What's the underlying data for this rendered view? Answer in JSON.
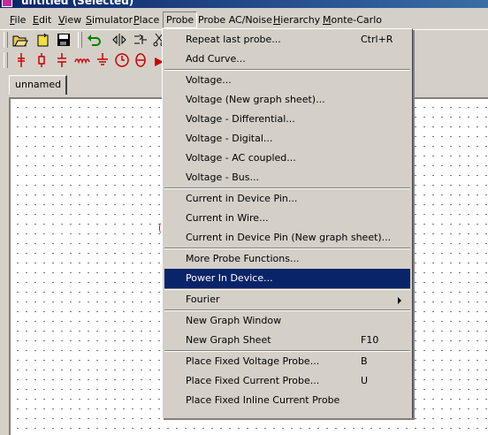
{
  "window": {
    "title": "untitled (Selected)"
  },
  "menubar": [
    {
      "label": "File",
      "u": "F",
      "rest": "ile"
    },
    {
      "label": "Edit",
      "u": "E",
      "rest": "dit"
    },
    {
      "label": "View",
      "u": "V",
      "rest": "iew"
    },
    {
      "label": "Simulator",
      "u": "S",
      "rest": "imulator"
    },
    {
      "label": "Place",
      "u": "P",
      "rest": "lace"
    },
    {
      "label": "Probe",
      "u": "",
      "rest": "Probe"
    },
    {
      "label": "Probe AC/Noise",
      "u": "",
      "rest": "Probe AC/Noise"
    },
    {
      "label": "Hierarchy",
      "u": "H",
      "rest": "ierarchy"
    },
    {
      "label": "Monte-Carlo",
      "u": "M",
      "rest": "onte-Carlo"
    }
  ],
  "tab": {
    "label": "unnamed"
  },
  "probe_menu": {
    "items": [
      {
        "label": "Repeat last probe...",
        "shortcut": "Ctrl+R"
      },
      {
        "label": "Add Curve...",
        "shortcut": ""
      },
      {
        "label": "Voltage...",
        "shortcut": ""
      },
      {
        "label": "Voltage (New graph sheet)...",
        "shortcut": ""
      },
      {
        "label": "Voltage - Differential...",
        "shortcut": ""
      },
      {
        "label": "Voltage - Digital...",
        "shortcut": ""
      },
      {
        "label": "Voltage - AC coupled...",
        "shortcut": ""
      },
      {
        "label": "Voltage - Bus...",
        "shortcut": ""
      },
      {
        "label": "Current in Device Pin...",
        "shortcut": ""
      },
      {
        "label": "Current in Wire...",
        "shortcut": ""
      },
      {
        "label": "Current in Device Pin (New graph sheet)...",
        "shortcut": ""
      },
      {
        "label": "More Probe Functions...",
        "shortcut": ""
      },
      {
        "label": "Power In Device...",
        "shortcut": ""
      },
      {
        "label": "Fourier",
        "shortcut": ""
      },
      {
        "label": "New Graph Window",
        "shortcut": ""
      },
      {
        "label": "New Graph Sheet",
        "shortcut": "F10"
      },
      {
        "label": "Place Fixed Voltage Probe...",
        "shortcut": "B"
      },
      {
        "label": "Place Fixed Current Probe...",
        "shortcut": "U"
      },
      {
        "label": "Place Fixed Inline Current Probe",
        "shortcut": ""
      }
    ]
  },
  "colors": {
    "highlight": "#0a246a",
    "face": "#d4d0c8",
    "titlebar": "#0a246a",
    "component_red": "#cc0000"
  },
  "toolbar_icons": {
    "row1": [
      "open-folder-icon",
      "new-doc-icon",
      "save-disk-icon",
      "undo-arrow-icon",
      "flip-horizontal-icon",
      "flip-vertical-icon",
      "scissors-icon"
    ],
    "row2": [
      "probe-wire-icon",
      "resistor-icon",
      "capacitor-icon",
      "inductor-icon",
      "ground-icon",
      "voltage-source-icon",
      "current-source-icon",
      "probe-arrow-icon"
    ]
  }
}
